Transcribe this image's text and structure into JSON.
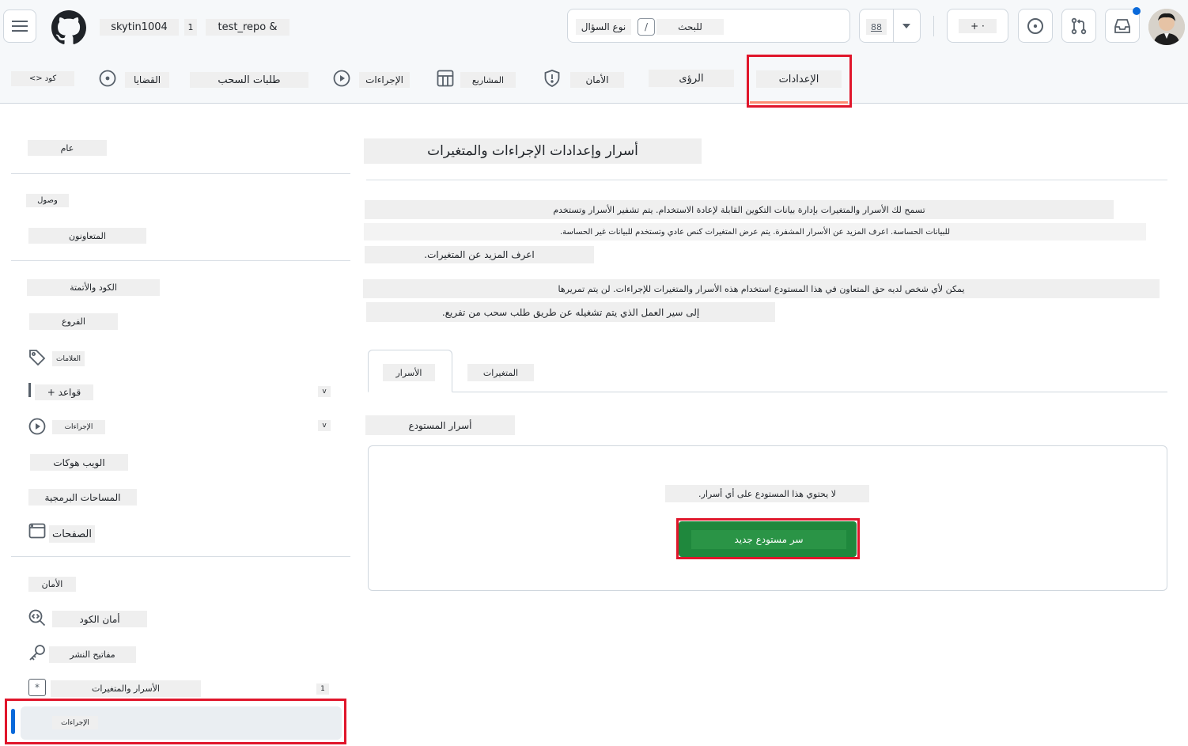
{
  "header": {
    "owner": "skytin1004",
    "sep": "1",
    "repo": "test_repo &",
    "search_label": "للبحث",
    "search_key": "/",
    "search_hint": "نوع السؤال",
    "copilot_label": "88",
    "create_label": "+ ·"
  },
  "repo_nav": {
    "code": "<> كود",
    "issues": "القضايا",
    "pulls": "طلبات السحب",
    "actions": "الإجراءات",
    "projects": "المشاريع",
    "security": "الأمان",
    "insights": "الرؤى",
    "settings": "الإعدادات"
  },
  "sidebar": {
    "general": "عام",
    "access_heading": "وصول",
    "collaborators": "المتعاونون",
    "code_heading": "الكود والأتمتة",
    "branches": "الفروع",
    "tags": "العلامات",
    "rules": "+ قواعد",
    "rules_chevron": "v",
    "actions": "الإجراءات",
    "actions_chevron": "v",
    "webhooks": "الويب هوكات",
    "codespaces": "المساحات البرمجية",
    "pages": "الصفحات",
    "security_heading": "الأمان",
    "code_security": "أمان الكود",
    "deploy_keys": "مفاتيح النشر",
    "secrets_vars": "الأسرار والمتغيرات",
    "secrets_vars_badge": "1",
    "actions_sub": "الإجراءات"
  },
  "main": {
    "title": "أسرار وإعدادات الإجراءات والمتغيرات",
    "desc_line1": "تسمح لك الأسرار والمتغيرات بإدارة بيانات التكوين القابلة لإعادة الاستخدام. يتم تشفير الأسرار وتستخدم",
    "desc_line2": "للبيانات الحساسة. اعرف المزيد عن الأسرار المشفرة. يتم عرض المتغيرات كنص عادي وتستخدم للبيانات غير الحساسة.",
    "desc_line3": "اعرف المزيد عن المتغيرات.",
    "desc_line4": "يمكن لأي شخص لديه حق المتعاون في هذا المستودع استخدام هذه الأسرار والمتغيرات للإجراءات. لن يتم تمريرها",
    "desc_line5": "إلى سير العمل الذي يتم تشغيله عن طريق طلب سحب من تفريع.",
    "tab_secrets": "الأسرار",
    "tab_variables": "المتغيرات",
    "repo_secrets_heading": "أسرار المستودع",
    "empty_text": "لا يحتوي هذا المستودع على أي أسرار.",
    "new_secret_button": "سر مستودع جديد"
  },
  "colors": {
    "accent_red": "#e0162b",
    "primary_green": "#1f883d",
    "active_blue": "#0969da",
    "notification_dot": "#0969da"
  }
}
